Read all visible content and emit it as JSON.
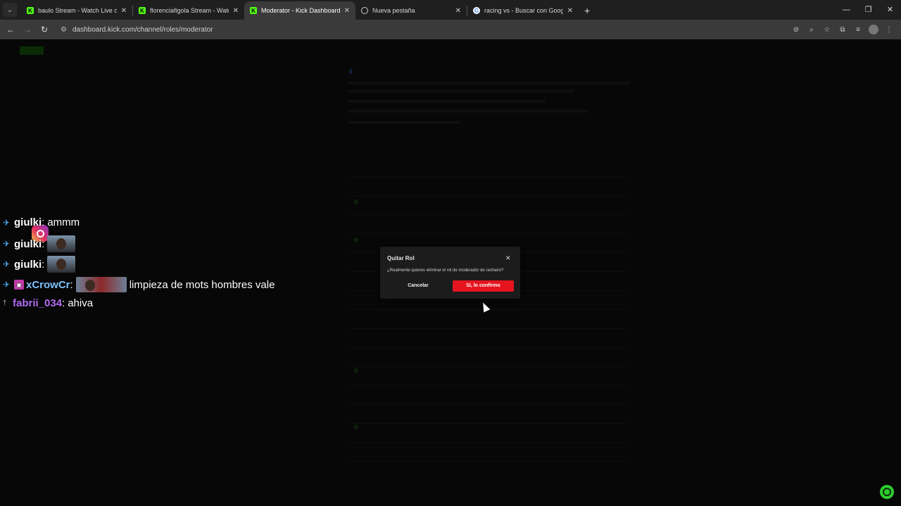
{
  "browser": {
    "tabs": [
      {
        "title": "baulo Stream - Watch Live on K",
        "favicon": "kick-icon",
        "active": false
      },
      {
        "title": "florenciafigola Stream - Watch L",
        "favicon": "kick-icon",
        "active": false
      },
      {
        "title": "Moderator - Kick Dashboard",
        "favicon": "kick-icon",
        "active": true
      },
      {
        "title": "Nueva pestaña",
        "favicon": "globe-icon",
        "active": false
      },
      {
        "title": "racing vs - Buscar con Google",
        "favicon": "google-icon",
        "active": false
      }
    ],
    "url": "dashboard.kick.com/channel/roles/moderator"
  },
  "chat": [
    {
      "user": "giulki",
      "message": "ammm",
      "emotes": 0
    },
    {
      "user": "giulki",
      "message": "",
      "emotes": 1
    },
    {
      "user": "giulki",
      "message": "",
      "emotes": 1
    },
    {
      "user": "xCrowCr",
      "message": "limpieza de mots hombres vale",
      "emotes": 1
    },
    {
      "user": "fabrii_034",
      "message": "ahiva",
      "emotes": 0
    }
  ],
  "modal": {
    "title": "Quitar Rol",
    "text": "¿Realmente quieres eliminar el rol de moderador de rashairo?",
    "cancel": "Cancelar",
    "confirm": "Sí, lo confirmo"
  },
  "colors": {
    "accent": "#53fc18",
    "confirm": "#e5141f"
  }
}
